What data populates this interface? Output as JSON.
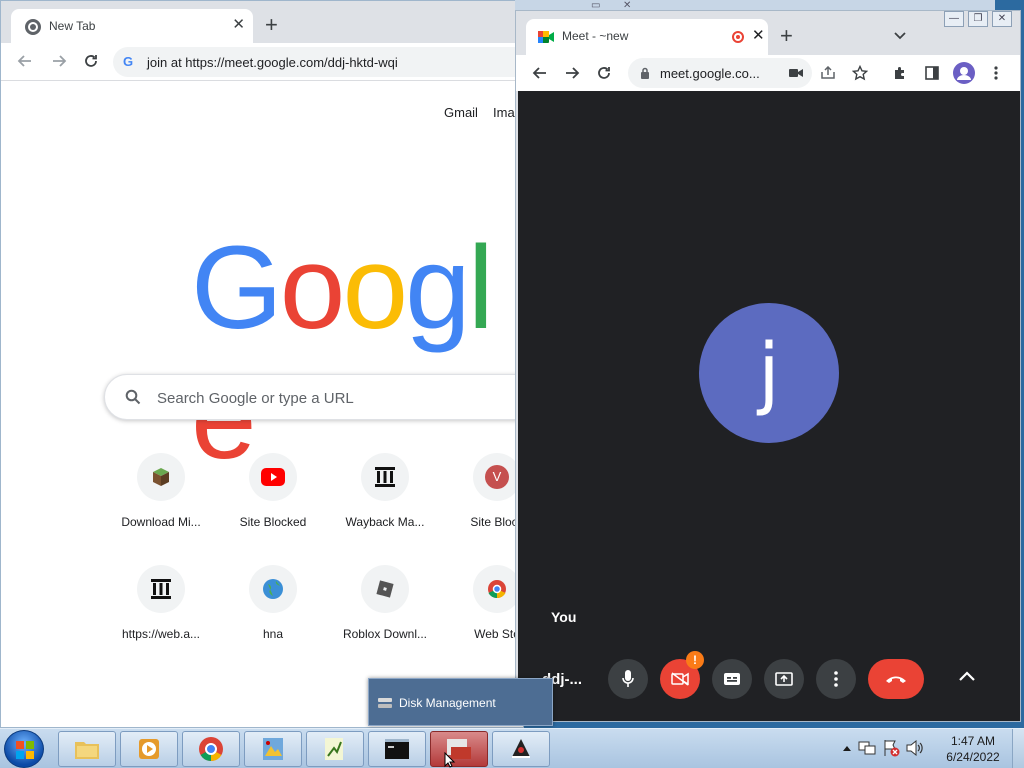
{
  "left_browser": {
    "tab_title": "New Tab",
    "tab_close": "✕",
    "new_tab": "+",
    "omnibox_text": "join at https://meet.google.com/ddj-hktd-wqi",
    "top_links": [
      "Gmail",
      "Ima"
    ],
    "logo": [
      "G",
      "o",
      "o",
      "g",
      "l",
      "e"
    ],
    "logo_colors": [
      "#4285f4",
      "#ea4335",
      "#fbbc05",
      "#4285f4",
      "#34a853",
      "#ea4335"
    ],
    "search_placeholder": "Search Google or type a URL",
    "shortcuts": [
      {
        "label": "Download Mi...",
        "icon": "minecraft-block-icon"
      },
      {
        "label": "Site Blocked",
        "icon": "youtube-icon"
      },
      {
        "label": "Wayback Ma...",
        "icon": "archive-building-icon"
      },
      {
        "label": "Site Block",
        "icon": "letter-v-icon"
      },
      {
        "label": "https://web.a...",
        "icon": "archive-building-icon"
      },
      {
        "label": "hna",
        "icon": "globe-icon"
      },
      {
        "label": "Roblox Downl...",
        "icon": "roblox-icon"
      },
      {
        "label": "Web Sto",
        "icon": "chrome-webstore-icon"
      }
    ],
    "shortcut_v_letter": "V"
  },
  "meet_window": {
    "tab_title": "Meet - ~new",
    "tab_close": "✕",
    "new_tab": "+",
    "url": "meet.google.co...",
    "avatar_letter": "j",
    "self_label": "You",
    "meeting_code": "ddj-...",
    "warning_badge": "!",
    "caption_buttons": [
      "—",
      "❐",
      "✕"
    ]
  },
  "popup": {
    "label": "Disk Management"
  },
  "taskbar": {
    "time": "1:47 AM",
    "date": "6/24/2022",
    "buttons": [
      "explorer",
      "media-player",
      "chrome",
      "paint-app",
      "notepad-app",
      "cmd",
      "computer-management",
      "java-app"
    ]
  },
  "colors": {
    "meet_stage": "#202124",
    "avatar": "#5c6bc0",
    "leave_button": "#ea4335",
    "taskbar": "#b9cfe6"
  }
}
